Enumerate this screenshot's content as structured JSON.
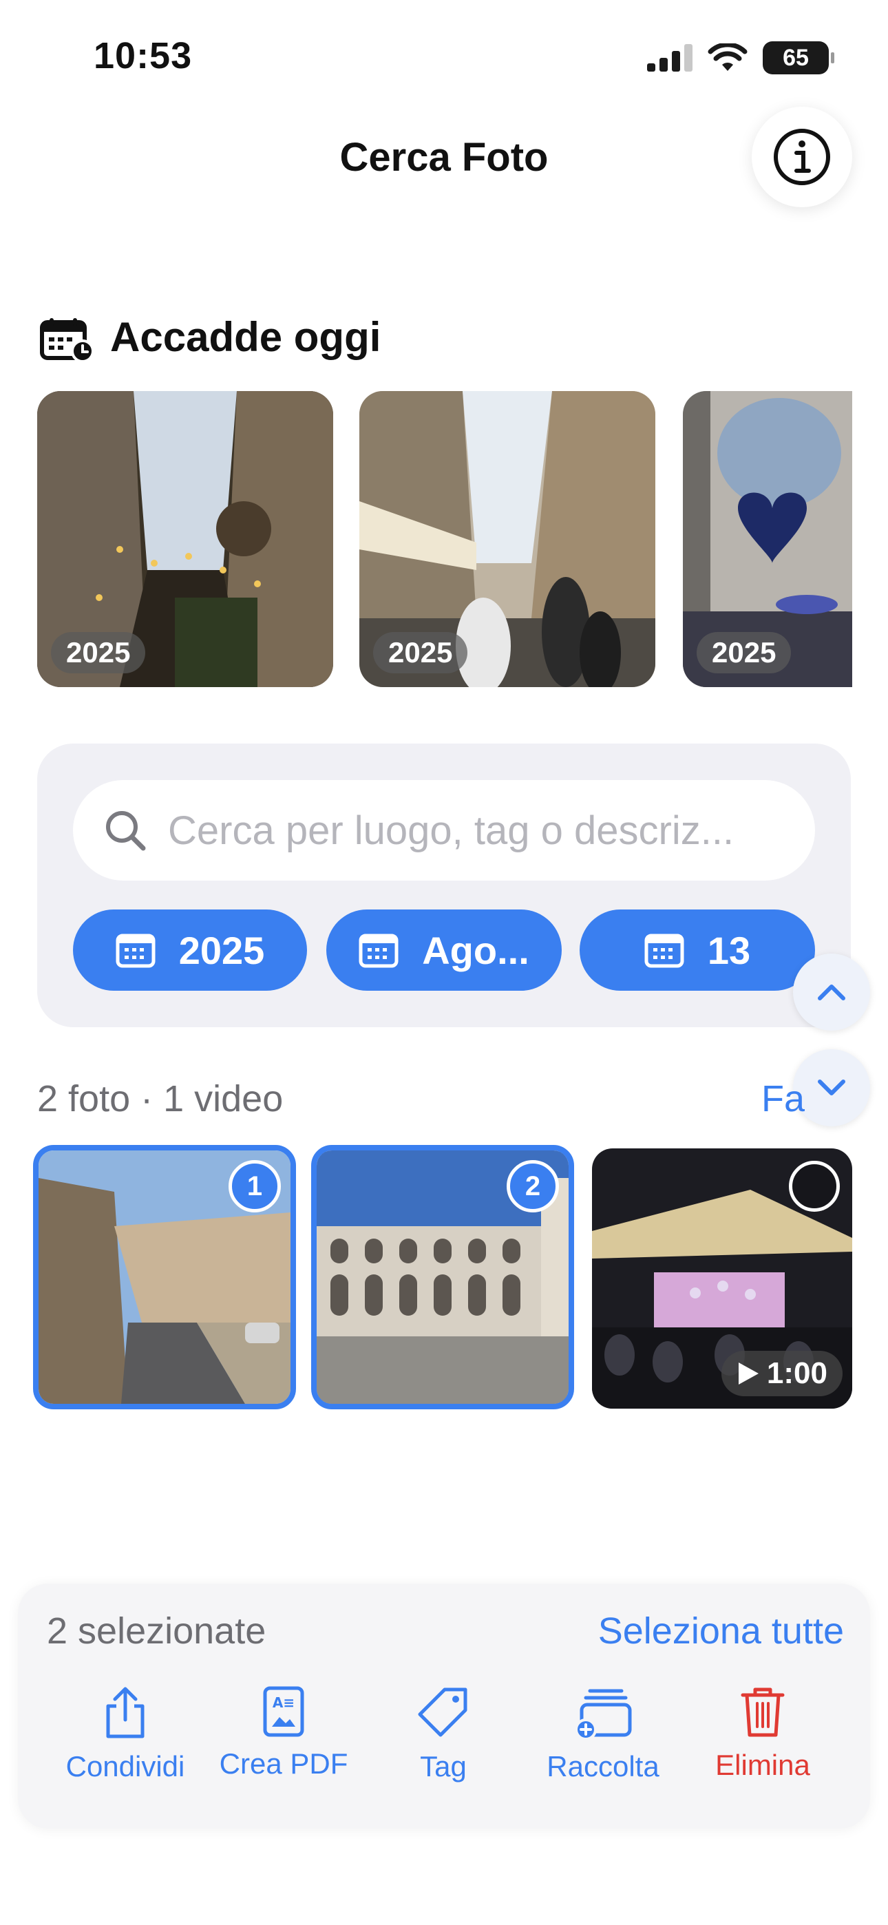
{
  "status_bar": {
    "time": "10:53",
    "battery": "65"
  },
  "header": {
    "title": "Cerca Foto",
    "info_icon": "info-circle-icon"
  },
  "on_this_day": {
    "title": "Accadde oggi",
    "icon": "calendar-clock-icon",
    "cards": [
      {
        "year": "2025"
      },
      {
        "year": "2025"
      },
      {
        "year": "2025"
      }
    ]
  },
  "search": {
    "placeholder": "Cerca per luogo, tag o descriz...",
    "value": "",
    "chips": [
      {
        "label": "2025",
        "icon": "calendar-icon"
      },
      {
        "label": "Ago...",
        "icon": "calendar-icon"
      },
      {
        "label": "13",
        "icon": "calendar-icon"
      }
    ]
  },
  "results": {
    "count_text": "2 foto · 1 video",
    "filter_link": "Fa",
    "items": [
      {
        "type": "photo",
        "selected": true,
        "order": "1"
      },
      {
        "type": "photo",
        "selected": true,
        "order": "2"
      },
      {
        "type": "video",
        "selected": false,
        "duration": "1:00"
      }
    ]
  },
  "selection_bar": {
    "selected_text": "2 selezionate",
    "select_all": "Seleziona tutte",
    "actions": [
      {
        "label": "Condividi",
        "icon": "share-icon"
      },
      {
        "label": "Crea PDF",
        "icon": "pdf-document-icon"
      },
      {
        "label": "Tag",
        "icon": "tag-icon"
      },
      {
        "label": "Raccolta",
        "icon": "add-to-collection-icon"
      },
      {
        "label": "Elimina",
        "icon": "trash-icon",
        "style": "destructive"
      }
    ]
  },
  "colors": {
    "accent": "#3a7ff0",
    "destructive": "#e03a33",
    "panel": "#f0f0f5"
  }
}
